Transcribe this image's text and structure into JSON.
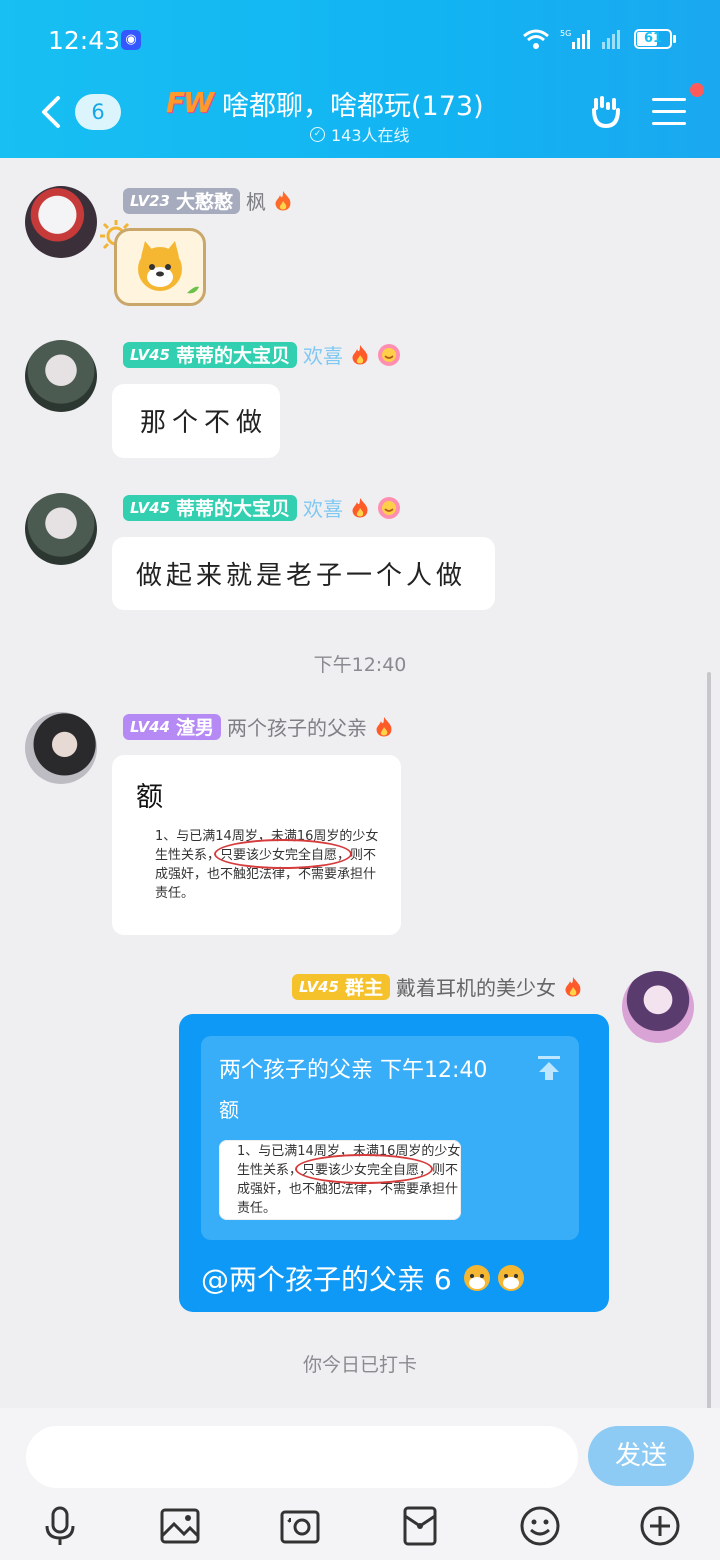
{
  "status_bar": {
    "time": "12:43",
    "network": "5G",
    "battery": "61"
  },
  "header": {
    "unread_count": "6",
    "group_logo": "FW",
    "group_name": "啥都聊，啥都玩(173)",
    "online_text": "143人在线"
  },
  "messages": [
    {
      "level": "LV23",
      "name": "大憨憨",
      "title": "枫",
      "type": "sticker"
    },
    {
      "level": "LV45",
      "name": "蒂蒂的大宝贝",
      "title": "欢喜",
      "text": "那个不做"
    },
    {
      "level": "LV45",
      "name": "蒂蒂的大宝贝",
      "title": "欢喜",
      "text": "做起来就是老子一个人做"
    },
    {
      "level": "LV44",
      "name": "渣男",
      "title": "两个孩子的父亲",
      "text": "额",
      "doc_lines": [
        "1、与已满14周岁，未满16周岁的少女",
        "生性关系，只要该少女完全自愿，则不",
        "成强奸，也不触犯法律，不需要承担什",
        "责任。"
      ]
    },
    {
      "level": "LV45",
      "name": "群主",
      "title": "戴着耳机的美少女",
      "quote_author": "两个孩子的父亲",
      "quote_time": "下午12:40",
      "quote_text": "额",
      "quote_doc_lines": [
        "1、与已满14周岁，未满16周岁的少女",
        "生性关系，只要该少女完全自愿，则不",
        "成强奸，也不触犯法律，不需要承担什",
        "责任。"
      ],
      "mention": "@两个孩子的父亲 6"
    }
  ],
  "timestamp": "下午12:40",
  "checkin_text": "你今日已打卡",
  "composer": {
    "send_label": "发送",
    "placeholder": ""
  },
  "colors": {
    "header": "#17bff2",
    "my_bubble": "#0e99f6",
    "send_button": "#8dcbf5"
  }
}
